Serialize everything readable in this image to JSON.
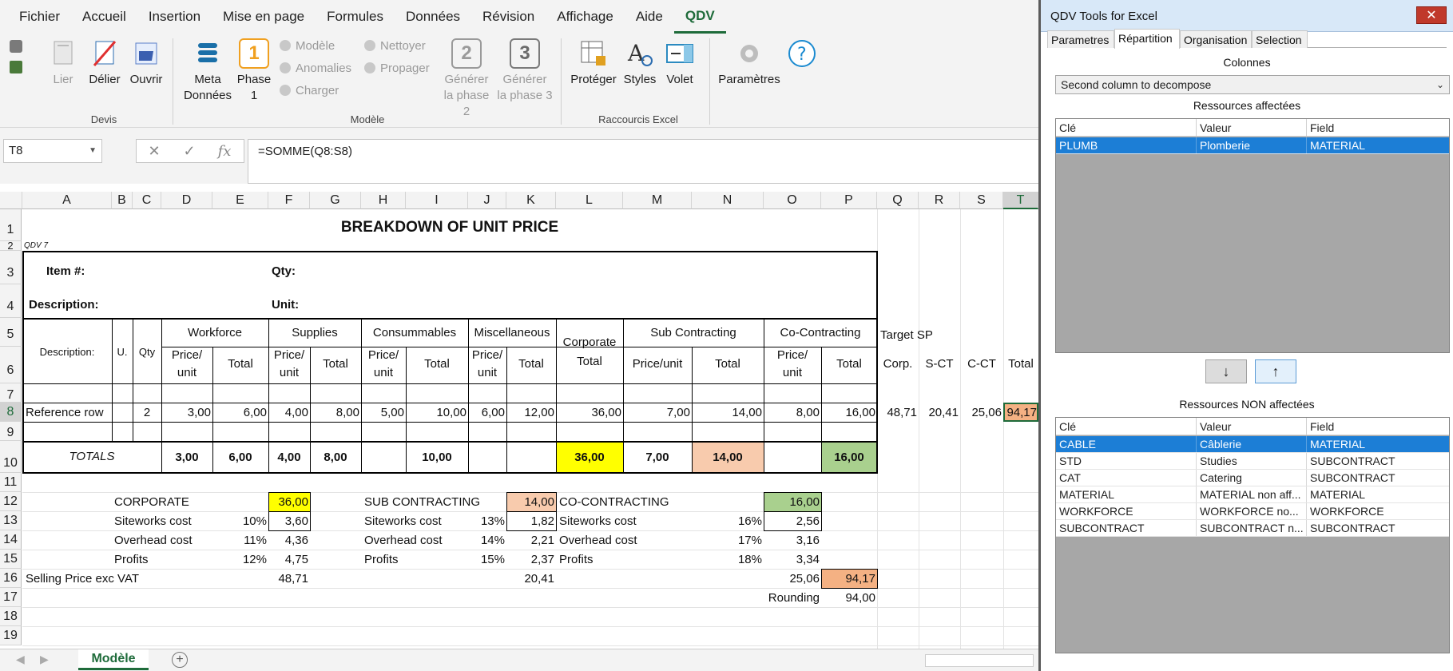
{
  "menubar": {
    "tabs": [
      "Fichier",
      "Accueil",
      "Insertion",
      "Mise en page",
      "Formules",
      "Données",
      "Révision",
      "Affichage",
      "Aide",
      "QDV"
    ],
    "active": "QDV"
  },
  "ribbon": {
    "devis": {
      "lier": "Lier",
      "delier": "Délier",
      "ouvrir": "Ouvrir",
      "label": "Devis"
    },
    "modele": {
      "meta_l1": "Meta",
      "meta_l2": "Données",
      "phase1_l1": "Phase",
      "phase1_l2": "1",
      "modele": "Modèle",
      "anomalies": "Anomalies",
      "charger": "Charger",
      "nettoyer": "Nettoyer",
      "propager": "Propager",
      "gen2_l1": "Générer",
      "gen2_l2": "la phase 2",
      "gen3_l1": "Générer",
      "gen3_l2": "la phase 3",
      "phase1_num": "1",
      "phase2_num": "2",
      "phase3_num": "3",
      "label": "Modèle"
    },
    "raccourcis": {
      "proteger": "Protéger",
      "styles": "Styles",
      "volet": "Volet",
      "label": "Raccourcis Excel"
    },
    "parametres": "Paramètres"
  },
  "formula_bar": {
    "name_box": "T8",
    "formula": "=SOMME(Q8:S8)",
    "cancel": "✕",
    "enter": "✓",
    "fx": "fx"
  },
  "columns": [
    "A",
    "B",
    "C",
    "D",
    "E",
    "F",
    "G",
    "H",
    "I",
    "J",
    "K",
    "L",
    "M",
    "N",
    "O",
    "P",
    "Q",
    "R",
    "S",
    "T"
  ],
  "rows": [
    "1",
    "2",
    "3",
    "4",
    "5",
    "6",
    "7",
    "8",
    "9",
    "10",
    "11",
    "12",
    "13",
    "14",
    "15",
    "16",
    "17",
    "18",
    "19"
  ],
  "sheet": {
    "title": "BREAKDOWN OF UNIT PRICE",
    "qdv_tag": "QDV 7",
    "item_label": "Item #:",
    "qty_label": "Qty:",
    "description_label": "Description:",
    "unit_label": "Unit:",
    "hdr_description": "Description:",
    "hdr_u": "U.",
    "hdr_qty": "Qty",
    "groups": {
      "workforce": "Workforce",
      "supplies": "Supplies",
      "consumables": "Consummables",
      "misc": "Miscellaneous",
      "corporate_l1": "Corporate",
      "corporate_l2": "Total",
      "subcontracting": "Sub Contracting",
      "cocontracting": "Co-Contracting",
      "target": "Target SP"
    },
    "sub": {
      "price_l1": "Price/",
      "price_l2": "unit",
      "total": "Total",
      "priceunit": "Price/unit",
      "corp": "Corp.",
      "sct": "S-CT",
      "cct": "C-CT"
    },
    "ref_row": {
      "label": "Reference row",
      "qty": "2",
      "d": "3,00",
      "e": "6,00",
      "f": "4,00",
      "g": "8,00",
      "h": "5,00",
      "i": "10,00",
      "j": "6,00",
      "k": "12,00",
      "l": "36,00",
      "m": "7,00",
      "n": "14,00",
      "o": "8,00",
      "p": "16,00",
      "q": "48,71",
      "r": "20,41",
      "s": "25,06",
      "t": "94,17"
    },
    "totals": {
      "label": "TOTALS",
      "d": "3,00",
      "e": "6,00",
      "f": "4,00",
      "g": "8,00",
      "i": "10,00",
      "l": "36,00",
      "m": "7,00",
      "n": "14,00",
      "p": "16,00"
    },
    "summary": {
      "corporate": "CORPORATE",
      "corporate_val": "36,00",
      "siteworks": "Siteworks cost",
      "overhead": "Overhead cost",
      "profits": "Profits",
      "c_site_pct": "10%",
      "c_site": "3,60",
      "c_over_pct": "11%",
      "c_over": "4,36",
      "c_prof_pct": "12%",
      "c_prof": "4,75",
      "sub": "SUB CONTRACTING",
      "sub_val": "14,00",
      "s_site_pct": "13%",
      "s_site": "1,82",
      "s_over_pct": "14%",
      "s_over": "2,21",
      "s_prof_pct": "15%",
      "s_prof": "2,37",
      "co": "CO-CONTRACTING",
      "co_val": "16,00",
      "o_site_pct": "16%",
      "o_site": "2,56",
      "o_over_pct": "17%",
      "o_over": "3,16",
      "o_prof_pct": "18%",
      "o_prof": "3,34",
      "selling": "Selling Price  exc VAT",
      "sell_c": "48,71",
      "sell_s": "20,41",
      "sell_o": "25,06",
      "sell_total": "94,17",
      "rounding": "Rounding",
      "rounding_val": "94,00"
    }
  },
  "sheet_tab": "Modèle",
  "colors": {
    "yellow": "#ffff00",
    "salmon": "#f8cbad",
    "green": "#a9d08e",
    "orange": "#f4b183"
  },
  "panel": {
    "title": "QDV Tools for Excel",
    "close": "✕",
    "tabs": [
      "Parametres",
      "Répartition",
      "Organisation",
      "Selection"
    ],
    "active_tab": "Répartition",
    "colonnes_label": "Colonnes",
    "combo_value": "Second column to decompose",
    "affected_label": "Ressources affectées",
    "nonaffected_label": "Ressources NON affectées",
    "headers": [
      "Clé",
      "Valeur",
      "Field"
    ],
    "affected": [
      {
        "key": "PLUMB",
        "value": "Plomberie",
        "field": "MATERIAL"
      }
    ],
    "nonaffected": [
      {
        "key": "CABLE",
        "value": "Câblerie",
        "field": "MATERIAL"
      },
      {
        "key": "STD",
        "value": "Studies",
        "field": "SUBCONTRACT"
      },
      {
        "key": "CAT",
        "value": "Catering",
        "field": "SUBCONTRACT"
      },
      {
        "key": "MATERIAL",
        "value": "MATERIAL non aff...",
        "field": "MATERIAL"
      },
      {
        "key": "WORKFORCE",
        "value": "WORKFORCE no...",
        "field": "WORKFORCE"
      },
      {
        "key": "SUBCONTRACT",
        "value": "SUBCONTRACT n...",
        "field": "SUBCONTRACT"
      }
    ],
    "down_arrow": "↓",
    "up_arrow": "↑"
  }
}
